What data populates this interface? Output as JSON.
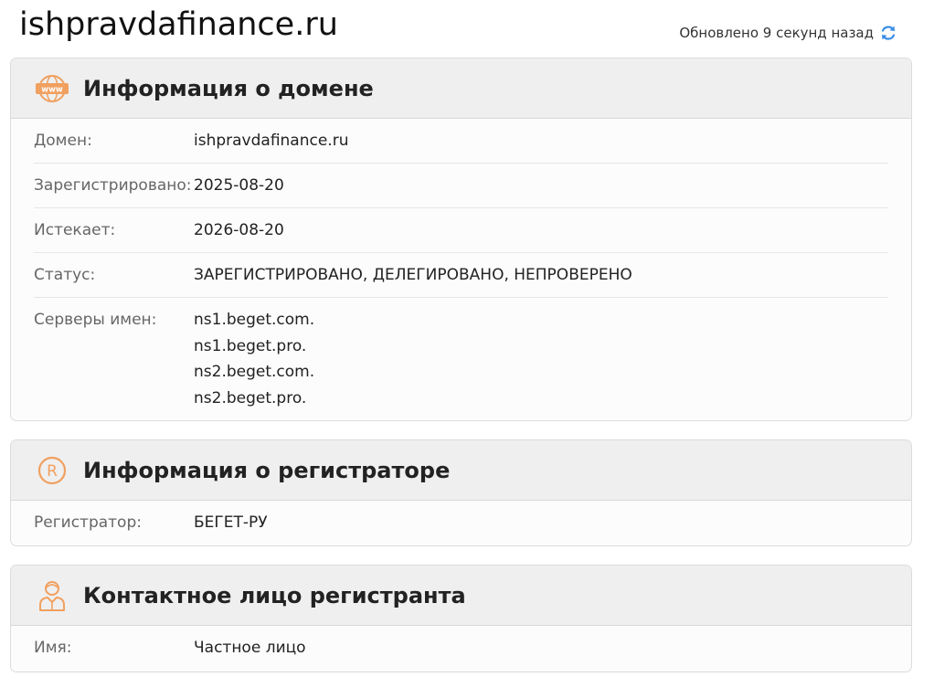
{
  "header": {
    "title": "ishpravdafinance.ru",
    "updated_text": "Обновлено 9 секунд назад",
    "refresh_icon": "refresh-icon"
  },
  "colors": {
    "accent_orange": "#f0a060",
    "accent_blue": "#3a8ee6"
  },
  "domain_info": {
    "title": "Информация о домене",
    "icon": "www-icon",
    "rows": [
      {
        "label": "Домен:",
        "value": "ishpravdafinance.ru"
      },
      {
        "label": "Зарегистрировано:",
        "value": "2025-08-20"
      },
      {
        "label": "Истекает:",
        "value": "2026-08-20"
      },
      {
        "label": "Статус:",
        "value": "ЗАРЕГИСТРИРОВАНО, ДЕЛЕГИРОВАНО, НЕПРОВЕРЕНО"
      }
    ],
    "nameservers_label": "Серверы имен:",
    "nameservers": [
      "ns1.beget.com.",
      "ns1.beget.pro.",
      "ns2.beget.com.",
      "ns2.beget.pro."
    ]
  },
  "registrar_info": {
    "title": "Информация о регистраторе",
    "icon": "registered-icon",
    "rows": [
      {
        "label": "Регистратор:",
        "value": "БЕГЕТ-РУ"
      }
    ]
  },
  "registrant_contact": {
    "title": "Контактное лицо регистранта",
    "icon": "person-icon",
    "rows": [
      {
        "label": "Имя:",
        "value": "Частное лицо"
      }
    ]
  }
}
